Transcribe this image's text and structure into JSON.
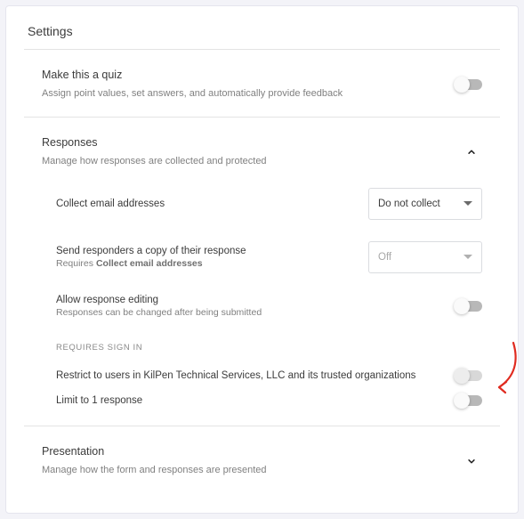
{
  "title": "Settings",
  "quiz": {
    "heading": "Make this a quiz",
    "sub": "Assign point values, set answers, and automatically provide feedback"
  },
  "responses": {
    "heading": "Responses",
    "sub": "Manage how responses are collected and protected",
    "collect_label": "Collect email addresses",
    "collect_value": "Do not collect",
    "send_copy_label": "Send responders a copy of their response",
    "send_copy_req_pre": "Requires ",
    "send_copy_req_bold": "Collect email addresses",
    "send_copy_value": "Off",
    "allow_edit_label": "Allow response editing",
    "allow_edit_sub": "Responses can be changed after being submitted",
    "signin_heading": "REQUIRES SIGN IN",
    "restrict_label": "Restrict to users in KilPen Technical Services, LLC and its trusted organizations",
    "limit_label": "Limit to 1 response"
  },
  "presentation": {
    "heading": "Presentation",
    "sub": "Manage how the form and responses are presented"
  }
}
